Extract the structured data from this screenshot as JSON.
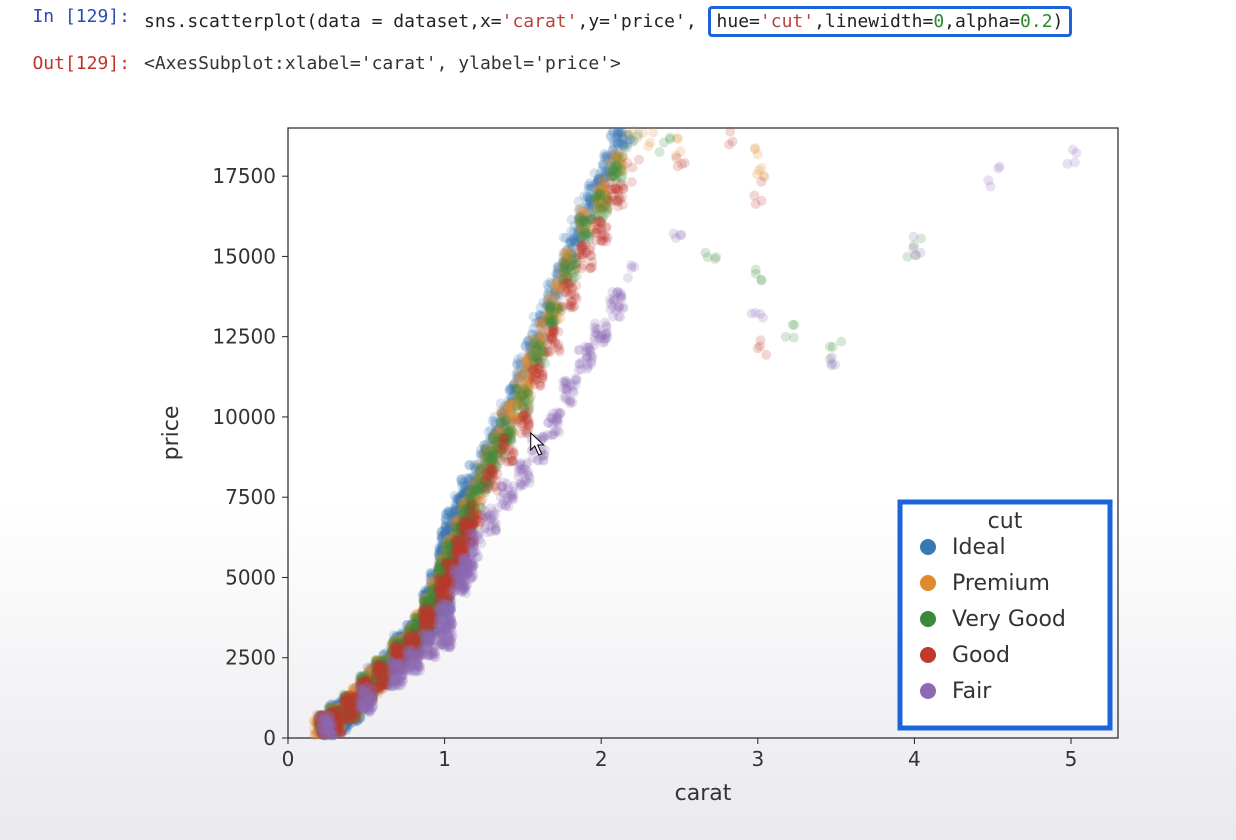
{
  "cell": {
    "in_prompt": "In [129]:",
    "out_prompt": "Out[129]:",
    "code_tokens": [
      {
        "t": "sns.scatterplot(data = dataset,x=",
        "cls": "tok-func"
      },
      {
        "t": "'carat'",
        "cls": "tok-str"
      },
      {
        "t": ",y=",
        "cls": "tok-func"
      },
      {
        "t": "'price'",
        "cls": "tok-func"
      },
      {
        "t": ", ",
        "cls": "tok-func"
      }
    ],
    "code_highlight_tokens": [
      {
        "t": "hue=",
        "cls": "tok-func"
      },
      {
        "t": "'cut'",
        "cls": "tok-str"
      },
      {
        "t": ",linewidth=",
        "cls": "tok-func"
      },
      {
        "t": "0",
        "cls": "tok-num"
      },
      {
        "t": ",alpha=",
        "cls": "tok-func"
      },
      {
        "t": "0.2",
        "cls": "tok-num"
      },
      {
        "t": ")",
        "cls": "tok-func"
      }
    ],
    "output_text": "<AxesSubplot:xlabel='carat', ylabel='price'>"
  },
  "chart_data": {
    "type": "scatter",
    "title": "",
    "xlabel": "carat",
    "ylabel": "price",
    "xlim": [
      0,
      5.3
    ],
    "ylim": [
      0,
      19000
    ],
    "x_ticks": [
      0,
      1,
      2,
      3,
      4,
      5
    ],
    "y_ticks": [
      0,
      2500,
      5000,
      7500,
      10000,
      12500,
      15000,
      17500
    ],
    "hue": "cut",
    "alpha": 0.2,
    "linewidth": 0,
    "legend": {
      "title": "cut",
      "entries": [
        {
          "label": "Ideal",
          "color": "#3a78b4"
        },
        {
          "label": "Premium",
          "color": "#e08a2d"
        },
        {
          "label": "Very Good",
          "color": "#3b8a3b"
        },
        {
          "label": "Good",
          "color": "#c0392b"
        },
        {
          "label": "Fair",
          "color": "#8c6ab5"
        }
      ],
      "position": "lower right"
    },
    "series": [
      {
        "name": "Ideal",
        "color": "#3a78b4",
        "points": [
          [
            0.23,
            326
          ],
          [
            0.31,
            544
          ],
          [
            0.3,
            710
          ],
          [
            0.4,
            900
          ],
          [
            0.5,
            1600
          ],
          [
            0.55,
            1800
          ],
          [
            0.6,
            2000
          ],
          [
            0.7,
            2600
          ],
          [
            0.72,
            2800
          ],
          [
            0.8,
            3200
          ],
          [
            0.9,
            4100
          ],
          [
            0.92,
            4300
          ],
          [
            1.0,
            5500
          ],
          [
            1.01,
            5600
          ],
          [
            1.02,
            6200
          ],
          [
            1.05,
            6700
          ],
          [
            1.1,
            7200
          ],
          [
            1.2,
            8200
          ],
          [
            1.25,
            8800
          ],
          [
            1.3,
            9200
          ],
          [
            1.4,
            10100
          ],
          [
            1.5,
            11500
          ],
          [
            1.55,
            12000
          ],
          [
            1.6,
            12800
          ],
          [
            1.7,
            13800
          ],
          [
            1.8,
            15200
          ],
          [
            1.9,
            16500
          ],
          [
            2.0,
            17200
          ],
          [
            2.05,
            17800
          ],
          [
            2.1,
            18500
          ],
          [
            2.15,
            18800
          ],
          [
            1.0,
            4200
          ],
          [
            0.9,
            3600
          ],
          [
            0.95,
            4800
          ],
          [
            0.85,
            3400
          ],
          [
            0.75,
            2900
          ],
          [
            0.65,
            2300
          ],
          [
            0.35,
            720
          ],
          [
            0.42,
            950
          ],
          [
            0.47,
            1200
          ],
          [
            1.15,
            7700
          ],
          [
            1.35,
            9700
          ],
          [
            1.45,
            10800
          ],
          [
            1.65,
            13200
          ],
          [
            1.75,
            14500
          ],
          [
            1.85,
            15800
          ],
          [
            1.95,
            16900
          ],
          [
            0.28,
            450
          ],
          [
            0.33,
            620
          ],
          [
            0.38,
            820
          ]
        ]
      },
      {
        "name": "Premium",
        "color": "#e08a2d",
        "points": [
          [
            0.21,
            326
          ],
          [
            0.3,
            600
          ],
          [
            0.4,
            1000
          ],
          [
            0.5,
            1500
          ],
          [
            0.6,
            2100
          ],
          [
            0.7,
            2700
          ],
          [
            0.8,
            3100
          ],
          [
            0.9,
            4000
          ],
          [
            1.0,
            5000
          ],
          [
            1.01,
            5300
          ],
          [
            1.05,
            5800
          ],
          [
            1.1,
            6500
          ],
          [
            1.2,
            7600
          ],
          [
            1.3,
            8800
          ],
          [
            1.4,
            9800
          ],
          [
            1.5,
            10700
          ],
          [
            1.51,
            11000
          ],
          [
            1.6,
            12200
          ],
          [
            1.7,
            13400
          ],
          [
            1.8,
            14800
          ],
          [
            1.9,
            16100
          ],
          [
            2.0,
            16800
          ],
          [
            2.01,
            17000
          ],
          [
            2.1,
            17900
          ],
          [
            2.2,
            18600
          ],
          [
            2.3,
            18800
          ],
          [
            2.5,
            18500
          ],
          [
            3.0,
            18000
          ],
          [
            3.01,
            17500
          ],
          [
            1.15,
            7000
          ],
          [
            1.25,
            8200
          ],
          [
            1.35,
            9300
          ],
          [
            1.45,
            10300
          ],
          [
            1.55,
            11600
          ],
          [
            1.65,
            12900
          ],
          [
            1.75,
            14200
          ],
          [
            0.85,
            3500
          ],
          [
            0.95,
            4500
          ],
          [
            0.45,
            1200
          ],
          [
            0.55,
            1750
          ]
        ]
      },
      {
        "name": "Very Good",
        "color": "#3b8a3b",
        "points": [
          [
            0.24,
            336
          ],
          [
            0.3,
            550
          ],
          [
            0.4,
            980
          ],
          [
            0.5,
            1550
          ],
          [
            0.6,
            2050
          ],
          [
            0.7,
            2650
          ],
          [
            0.8,
            3050
          ],
          [
            0.9,
            3950
          ],
          [
            1.0,
            5100
          ],
          [
            1.1,
            6300
          ],
          [
            1.2,
            7500
          ],
          [
            1.3,
            8600
          ],
          [
            1.4,
            9600
          ],
          [
            1.5,
            10500
          ],
          [
            1.6,
            12000
          ],
          [
            1.7,
            13200
          ],
          [
            1.8,
            14600
          ],
          [
            1.9,
            15900
          ],
          [
            2.0,
            16600
          ],
          [
            2.1,
            17700
          ],
          [
            2.2,
            18400
          ],
          [
            2.4,
            18600
          ],
          [
            2.7,
            15000
          ],
          [
            3.0,
            14500
          ],
          [
            3.2,
            12500
          ],
          [
            3.5,
            12000
          ],
          [
            4.0,
            15200
          ],
          [
            1.05,
            5700
          ],
          [
            1.15,
            6900
          ],
          [
            1.25,
            8000
          ],
          [
            1.35,
            9100
          ],
          [
            0.85,
            3400
          ],
          [
            0.95,
            4400
          ]
        ]
      },
      {
        "name": "Good",
        "color": "#c0392b",
        "points": [
          [
            0.23,
            327
          ],
          [
            0.3,
            520
          ],
          [
            0.4,
            940
          ],
          [
            0.5,
            1450
          ],
          [
            0.6,
            1900
          ],
          [
            0.7,
            2500
          ],
          [
            0.8,
            2900
          ],
          [
            0.9,
            3700
          ],
          [
            1.0,
            4600
          ],
          [
            1.1,
            5800
          ],
          [
            1.2,
            7000
          ],
          [
            1.3,
            8000
          ],
          [
            1.4,
            9000
          ],
          [
            1.5,
            9800
          ],
          [
            1.6,
            11300
          ],
          [
            1.7,
            12400
          ],
          [
            1.8,
            13800
          ],
          [
            1.9,
            15000
          ],
          [
            2.0,
            15800
          ],
          [
            2.1,
            16900
          ],
          [
            2.2,
            17700
          ],
          [
            2.5,
            18000
          ],
          [
            2.8,
            18600
          ],
          [
            3.0,
            17000
          ],
          [
            3.01,
            12000
          ],
          [
            1.05,
            5100
          ],
          [
            1.15,
            6400
          ]
        ]
      },
      {
        "name": "Fair",
        "color": "#8c6ab5",
        "points": [
          [
            0.25,
            337
          ],
          [
            0.5,
            1200
          ],
          [
            0.7,
            2000
          ],
          [
            0.9,
            2900
          ],
          [
            1.0,
            3800
          ],
          [
            1.1,
            4900
          ],
          [
            1.2,
            6000
          ],
          [
            1.3,
            6800
          ],
          [
            1.4,
            7600
          ],
          [
            1.5,
            8200
          ],
          [
            1.6,
            9000
          ],
          [
            1.7,
            9800
          ],
          [
            1.8,
            10800
          ],
          [
            1.9,
            11800
          ],
          [
            2.0,
            12600
          ],
          [
            2.1,
            13500
          ],
          [
            2.2,
            14400
          ],
          [
            2.5,
            15800
          ],
          [
            3.0,
            13000
          ],
          [
            3.5,
            11500
          ],
          [
            4.0,
            15300
          ],
          [
            4.5,
            17500
          ],
          [
            5.01,
            18000
          ],
          [
            1.01,
            3200
          ],
          [
            1.15,
            5300
          ],
          [
            0.8,
            2400
          ]
        ]
      }
    ]
  }
}
